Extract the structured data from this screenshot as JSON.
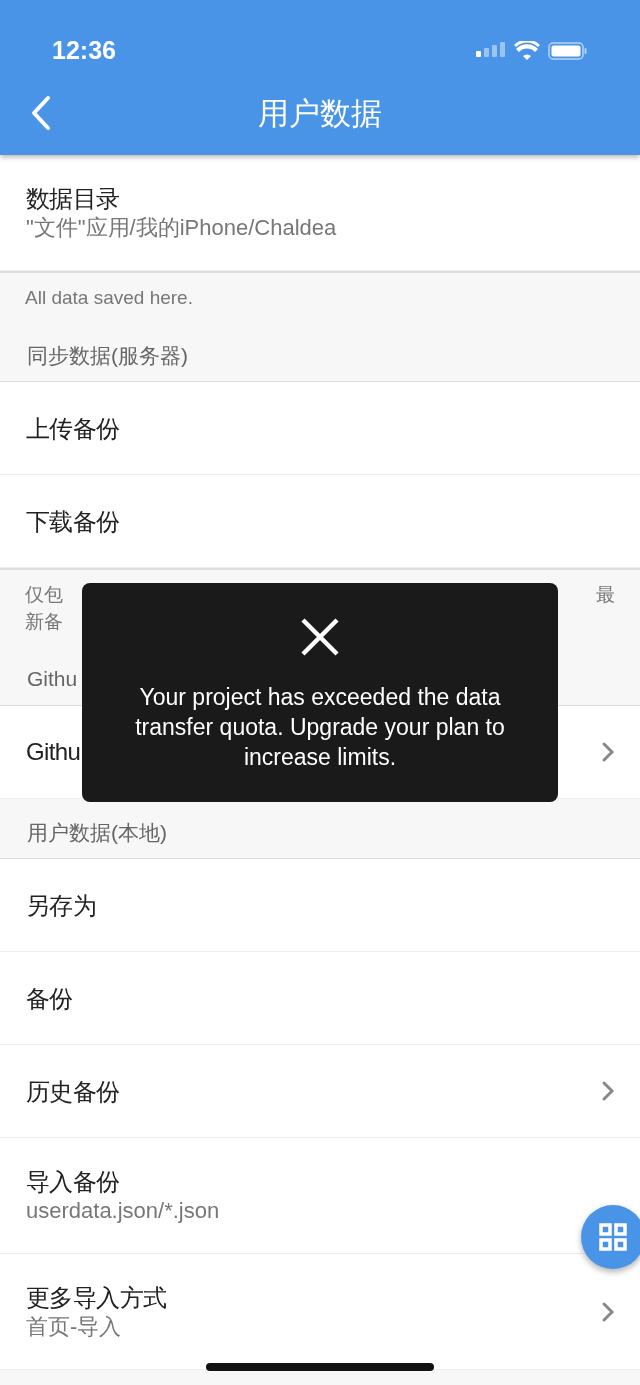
{
  "status_bar": {
    "time": "12:36"
  },
  "app_bar": {
    "title": "用户数据"
  },
  "blocks": [
    {
      "kind": "tile",
      "title": "数据目录",
      "subtitle": "\"文件\"应用/我的iPhone/Chaldea",
      "chevron": false
    },
    {
      "kind": "note",
      "text": "All data saved here."
    },
    {
      "kind": "header",
      "text": "同步数据(服务器)"
    },
    {
      "kind": "tile",
      "title": "上传备份",
      "chevron": false
    },
    {
      "kind": "tile",
      "title": "下载备份",
      "chevron": false
    },
    {
      "kind": "note_parts",
      "lines": [
        [
          "仅包",
          "最"
        ],
        [
          "新备"
        ]
      ]
    },
    {
      "kind": "header",
      "text": "Githu"
    },
    {
      "kind": "tile",
      "title": "Githu",
      "chevron": true
    },
    {
      "kind": "header",
      "text": "用户数据(本地)"
    },
    {
      "kind": "tile",
      "title": "另存为",
      "chevron": false
    },
    {
      "kind": "tile",
      "title": "备份",
      "chevron": false
    },
    {
      "kind": "tile",
      "title": "历史备份",
      "chevron": true
    },
    {
      "kind": "tile",
      "title": "导入备份",
      "subtitle": "userdata.json/*.json",
      "chevron": false
    },
    {
      "kind": "tile",
      "title": "更多导入方式",
      "subtitle": "首页-导入",
      "chevron": true
    }
  ],
  "toast": {
    "message": "Your project has exceeded the data transfer quota. Upgrade your plan to increase limits."
  }
}
